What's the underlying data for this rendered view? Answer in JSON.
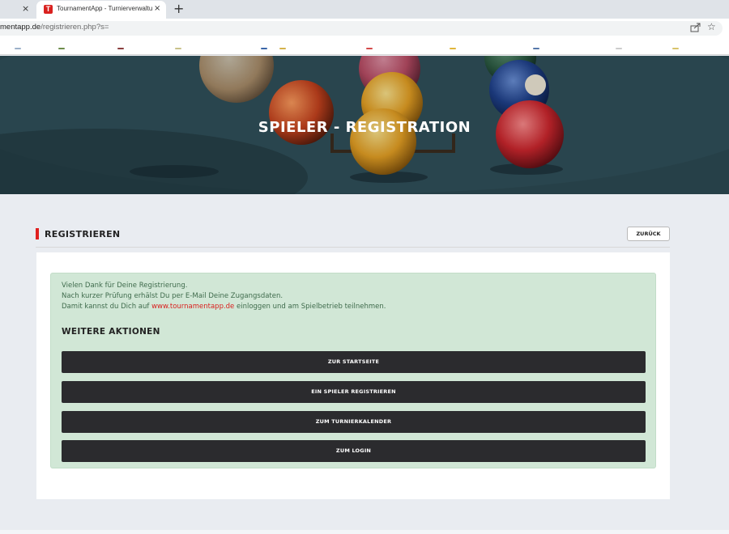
{
  "browser": {
    "prev_tab_close": "×",
    "tab": {
      "favicon_letter": "T",
      "title": "TournamentApp - Turnierverwaltung",
      "close": "×"
    },
    "new_tab": "+",
    "url": {
      "host": "mentapp.de",
      "path": "/registrieren.php?s="
    }
  },
  "hero": {
    "title": "SPIELER - REGISTRATION"
  },
  "section": {
    "title": "REGISTRIEREN",
    "back_label": "ZURÜCK"
  },
  "message": {
    "line1": "Vielen Dank für Deine Registrierung.",
    "line2": "Nach kurzer Prüfung erhälst Du per E-Mail Deine Zugangsdaten.",
    "line3_before": "Damit kannst du Dich auf ",
    "line3_link": "www.tournamentapp.de",
    "line3_after": " einloggen und am Spielbetrieb teilnehmen."
  },
  "actions": {
    "title": "WEITERE AKTIONEN",
    "buttons": [
      {
        "label": "ZUR STARTSEITE"
      },
      {
        "label": "EIN SPIELER REGISTRIEREN"
      },
      {
        "label": "ZUM TURNIERKALENDER"
      },
      {
        "label": "ZUM LOGIN"
      }
    ]
  },
  "colors": {
    "accent": "#e0201f",
    "button_bg": "#2b2b2e",
    "alert_bg": "#d1e7d6",
    "page_bg": "#e9ecf1"
  }
}
